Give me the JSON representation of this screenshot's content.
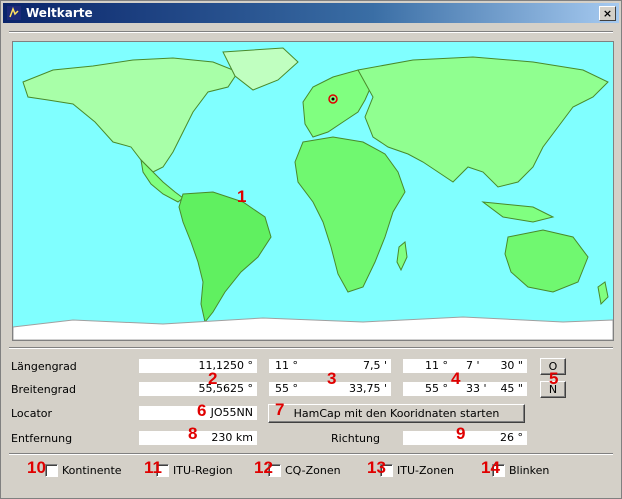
{
  "window": {
    "title": "Weltkarte",
    "close": "×"
  },
  "colors": {
    "ocean": "#80ffff",
    "land": "#80ff80",
    "land_light": "#c0ffc0",
    "antarctica": "#ffffff",
    "border": "#4a8a2a",
    "marker": "#e00000"
  },
  "map": {
    "marker_label": "1"
  },
  "fields": {
    "laengengrad": {
      "label": "Längengrad",
      "decimal": "11,1250 °",
      "deg": "11 °",
      "min": "7,5 '",
      "dms_deg": "11 °",
      "dms_min": "7 '",
      "dms_sec": "30 \"",
      "dir_button": "O"
    },
    "breitengrad": {
      "label": "Breitengrad",
      "decimal": "55,5625 °",
      "deg": "55 °",
      "min": "33,75 '",
      "dms_deg": "55 °",
      "dms_min": "33 '",
      "dms_sec": "45 \"",
      "dir_button": "N"
    },
    "locator": {
      "label": "Locator",
      "value": "JO55NN"
    },
    "entfernung": {
      "label": "Entfernung",
      "value": "230 km"
    },
    "richtung": {
      "label": "Richtung",
      "value": "26 °"
    }
  },
  "hamcap_button": "HamCap mit den Kooridnaten starten",
  "checkboxes": [
    {
      "label": "Kontinente",
      "checked": false
    },
    {
      "label": "ITU-Region",
      "checked": false
    },
    {
      "label": "CQ-Zonen",
      "checked": false
    },
    {
      "label": "ITU-Zonen",
      "checked": false
    },
    {
      "label": "Blinken",
      "checked": false
    }
  ],
  "annotations": [
    "1",
    "2",
    "3",
    "4",
    "5",
    "6",
    "7",
    "8",
    "9",
    "10",
    "11",
    "12",
    "13",
    "14"
  ]
}
